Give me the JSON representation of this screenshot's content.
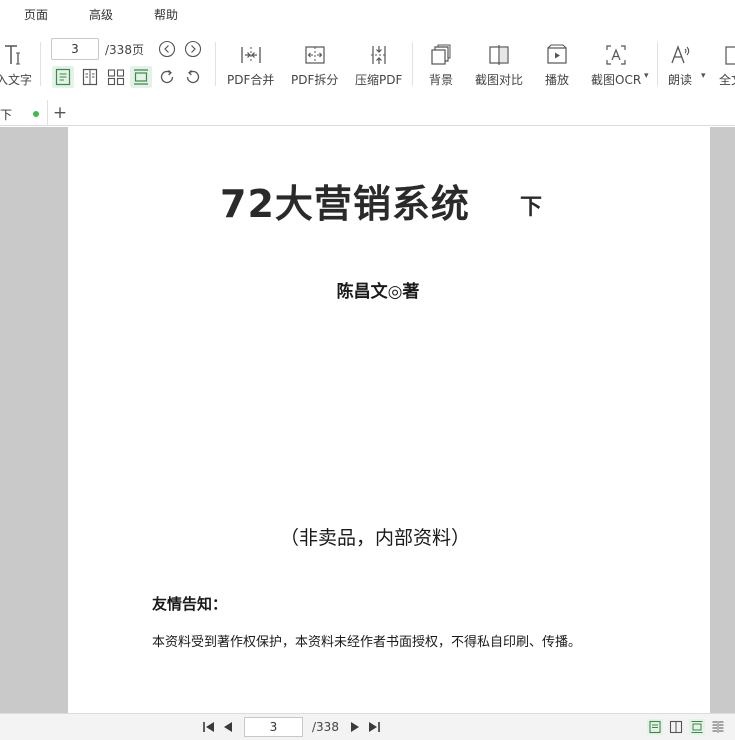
{
  "menu": {
    "items": [
      {
        "label": "页面"
      },
      {
        "label": "高级"
      },
      {
        "label": "帮助"
      }
    ]
  },
  "toolbar": {
    "insert_text_label": "入文字",
    "page": {
      "current": "3",
      "total": "/338页"
    },
    "buttons": {
      "pdf_merge": "PDF合并",
      "pdf_split": "PDF拆分",
      "compress_pdf": "压缩PDF",
      "background": "背景",
      "screenshot_compare": "截图对比",
      "play": "播放",
      "screenshot_ocr": "截图OCR",
      "read_aloud": "朗读",
      "full_text": "全文"
    }
  },
  "tabs": {
    "active_label": "下",
    "add_label": "+"
  },
  "document": {
    "title": "72大营销系统",
    "title_suffix": "下",
    "author": "陈昌文◎著",
    "note": "（非卖品，内部资料）",
    "notice_heading": "友情告知：",
    "notice_text": "本资料受到著作权保护，本资料未经作者书面授权，不得私自印刷、传播。"
  },
  "statusbar": {
    "page_current": "3",
    "page_total": "/338"
  },
  "colors": {
    "accent": "#3dbb4b",
    "active_bg": "#e4f2e7",
    "doc_bg": "#c9c9c9"
  }
}
